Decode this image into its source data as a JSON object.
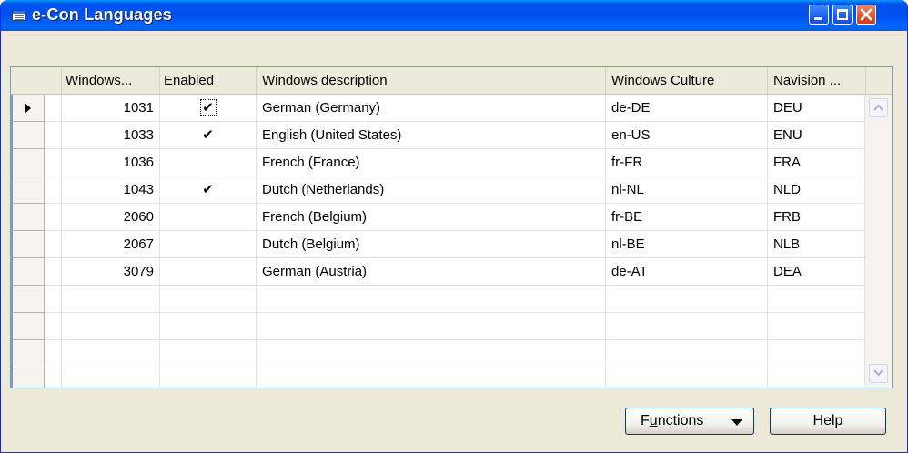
{
  "window": {
    "title": "e-Con Languages",
    "icon": "table-window-icon",
    "controls": {
      "minimize": "minimize-icon",
      "maximize": "maximize-icon",
      "close": "close-icon"
    }
  },
  "table": {
    "columns": [
      {
        "key": "windows_id",
        "label": "Windows..."
      },
      {
        "key": "enabled",
        "label": "Enabled"
      },
      {
        "key": "description",
        "label": "Windows description"
      },
      {
        "key": "culture",
        "label": "Windows Culture"
      },
      {
        "key": "navision",
        "label": "Navision ..."
      }
    ],
    "rows": [
      {
        "windows_id": "1031",
        "enabled": true,
        "description": "German (Germany)",
        "culture": "de-DE",
        "navision": "DEU",
        "current": true
      },
      {
        "windows_id": "1033",
        "enabled": true,
        "description": "English (United States)",
        "culture": "en-US",
        "navision": "ENU"
      },
      {
        "windows_id": "1036",
        "enabled": false,
        "description": "French (France)",
        "culture": "fr-FR",
        "navision": "FRA"
      },
      {
        "windows_id": "1043",
        "enabled": true,
        "description": "Dutch (Netherlands)",
        "culture": "nl-NL",
        "navision": "NLD"
      },
      {
        "windows_id": "2060",
        "enabled": false,
        "description": "French (Belgium)",
        "culture": "fr-BE",
        "navision": "FRB"
      },
      {
        "windows_id": "2067",
        "enabled": false,
        "description": "Dutch (Belgium)",
        "culture": "nl-BE",
        "navision": "NLB"
      },
      {
        "windows_id": "3079",
        "enabled": false,
        "description": "German (Austria)",
        "culture": "de-AT",
        "navision": "DEA"
      }
    ],
    "check_mark": "✔"
  },
  "buttons": {
    "functions_prefix": "F",
    "functions_underlined": "u",
    "functions_suffix": "nctions",
    "help": "Help"
  },
  "colors": {
    "titlebar": "#0053ee",
    "close_button": "#e0562f",
    "window_background": "#ece9d8"
  }
}
